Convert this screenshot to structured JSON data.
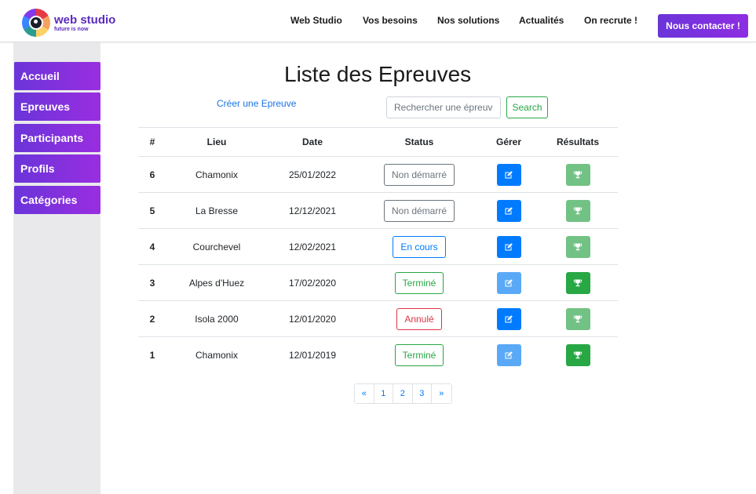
{
  "brand": {
    "name": "web studio",
    "tagline": "future is now"
  },
  "nav": {
    "items": [
      "Web Studio",
      "Vos besoins",
      "Nos solutions",
      "Actualités",
      "On recrute !"
    ],
    "contact_label": "Nous contacter !"
  },
  "sidebar": {
    "items": [
      "Accueil",
      "Epreuves",
      "Participants",
      "Profils",
      "Catégories"
    ]
  },
  "main": {
    "title": "Liste des Epreuves",
    "create_link": "Créer une Epreuve",
    "search_placeholder": "Rechercher une épreuve",
    "search_button": "Search"
  },
  "table": {
    "headers": [
      "#",
      "Lieu",
      "Date",
      "Status",
      "Gérer",
      "Résultats"
    ],
    "rows": [
      {
        "id": "6",
        "lieu": "Chamonix",
        "date": "25/01/2022",
        "status": "Non démarré",
        "status_kind": "grey",
        "edit_enabled": true,
        "results_enabled": false
      },
      {
        "id": "5",
        "lieu": "La Bresse",
        "date": "12/12/2021",
        "status": "Non démarré",
        "status_kind": "grey",
        "edit_enabled": true,
        "results_enabled": false
      },
      {
        "id": "4",
        "lieu": "Courchevel",
        "date": "12/02/2021",
        "status": "En cours",
        "status_kind": "blue",
        "edit_enabled": true,
        "results_enabled": false
      },
      {
        "id": "3",
        "lieu": "Alpes d'Huez",
        "date": "17/02/2020",
        "status": "Terminé",
        "status_kind": "green",
        "edit_enabled": false,
        "results_enabled": true
      },
      {
        "id": "2",
        "lieu": "Isola 2000",
        "date": "12/01/2020",
        "status": "Annulé",
        "status_kind": "red",
        "edit_enabled": true,
        "results_enabled": false
      },
      {
        "id": "1",
        "lieu": "Chamonix",
        "date": "12/01/2019",
        "status": "Terminé",
        "status_kind": "green",
        "edit_enabled": false,
        "results_enabled": true
      }
    ]
  },
  "pagination": [
    "«",
    "1",
    "2",
    "3",
    "»"
  ],
  "icons": {
    "edit": "edit-icon",
    "results": "trophy-icon"
  },
  "colors": {
    "accent": "#7b33dd",
    "primary": "#007bff",
    "success": "#28a745",
    "danger": "#dc3545"
  }
}
